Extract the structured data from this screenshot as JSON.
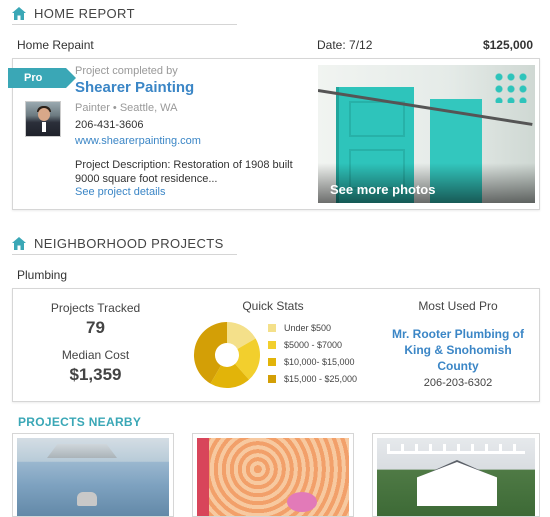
{
  "home_report": {
    "title": "HOME REPORT",
    "project_name": "Home Repaint",
    "date": "Date: 7/12",
    "price": "$125,000",
    "pro_tag": "Pro",
    "completed_by_label": "Project completed by",
    "company": "Shearer Painting",
    "role_location": "Painter • Seattle, WA",
    "phone": "206-431-3606",
    "website": "www.shearerpainting.com",
    "description": "Project Description: Restoration of 1908 built 9000 square foot residence...",
    "details_link": "See project details",
    "photo_cta": "See more photos"
  },
  "neighborhood": {
    "title": "NEIGHBORHOOD PROJECTS",
    "category": "Plumbing",
    "projects_tracked_label": "Projects Tracked",
    "projects_tracked_value": "79",
    "median_cost_label": "Median Cost",
    "median_cost_value": "$1,359",
    "quick_stats_title": "Quick Stats",
    "most_used_title": "Most Used Pro",
    "most_used_name": "Mr. Rooter Plumbing of King & Snohomish County",
    "most_used_phone": "206-203-6302",
    "legend": [
      {
        "label": "Under $500",
        "color": "#f4e08a"
      },
      {
        "label": "$5000 - $7000",
        "color": "#f2cf2d"
      },
      {
        "label": "$10,000- $15,000",
        "color": "#e2b409"
      },
      {
        "label": "$15,000 - $25,000",
        "color": "#d39f06"
      }
    ]
  },
  "nearby": {
    "title": "PROJECTS NEARBY"
  },
  "colors": {
    "accent": "#3aa7b6",
    "link": "#3b86c6"
  }
}
